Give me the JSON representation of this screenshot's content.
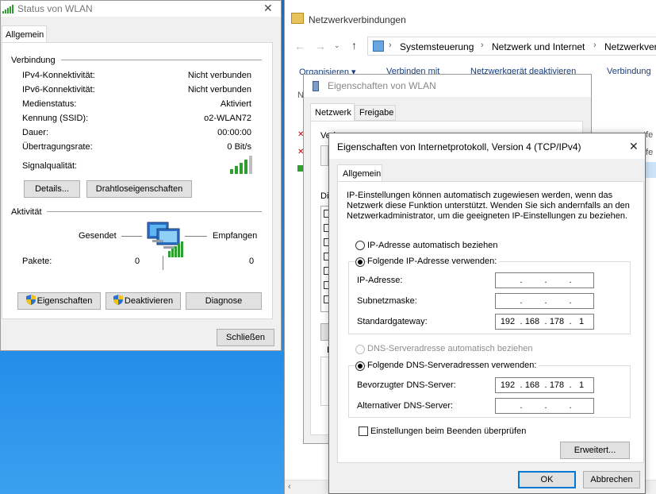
{
  "status_window": {
    "title": "Status von WLAN",
    "close": "✕",
    "tab": "Allgemein",
    "connection_header": "Verbindung",
    "rows": [
      {
        "label": "IPv4-Konnektivität:",
        "value": "Nicht verbunden"
      },
      {
        "label": "IPv6-Konnektivität:",
        "value": "Nicht verbunden"
      },
      {
        "label": "Medienstatus:",
        "value": "Aktiviert"
      },
      {
        "label": "Kennung (SSID):",
        "value": "o2-WLAN72"
      },
      {
        "label": "Dauer:",
        "value": "00:00:00"
      },
      {
        "label": "Übertragungsrate:",
        "value": "0 Bit/s"
      }
    ],
    "signal_label": "Signalqualität:",
    "details_button": "Details...",
    "wireless_button": "Drahtloseigenschaften",
    "activity_header": "Aktivität",
    "sent_label": "Gesendet",
    "received_label": "Empfangen",
    "packets_label": "Pakete:",
    "packets_sent": "0",
    "packets_received": "0",
    "properties_button": "Eigenschaften",
    "disable_button": "Deaktivieren",
    "diagnose_button": "Diagnose",
    "close_button": "Schließen"
  },
  "explorer": {
    "title": "Netzwerkverbindungen",
    "breadcrumb": [
      "Systemsteuerung",
      "Netzwerk und Internet",
      "Netzwerkverb"
    ],
    "toolbar": [
      "Organisieren ▾",
      "Verbinden mit",
      "Netzwerkgerät deaktivieren",
      "Verbindung"
    ],
    "partial_left": "N",
    "partial_right_1": "tfe",
    "partial_right_2": "tfe"
  },
  "wlan_props": {
    "title": "Eigenschaften von WLAN",
    "tabs": [
      "Netzwerk",
      "Freigabe"
    ],
    "partial_connect": "Verbindung herstellen über:",
    "partial_items": "Die",
    "partial_b": "B"
  },
  "ipv4": {
    "title": "Eigenschaften von Internetprotokoll, Version 4 (TCP/IPv4)",
    "tab": "Allgemein",
    "description": "IP-Einstellungen können automatisch zugewiesen werden, wenn das Netzwerk diese Funktion unterstützt. Wenden Sie sich andernfalls an den Netzwerkadministrator, um die geeigneten IP-Einstellungen zu beziehen.",
    "radio_auto_ip": "IP-Adresse automatisch beziehen",
    "radio_manual_ip": "Folgende IP-Adresse verwenden:",
    "ip_label": "IP-Adresse:",
    "subnet_label": "Subnetzmaske:",
    "gateway_label": "Standardgateway:",
    "ip_value": [
      "",
      "",
      "",
      ""
    ],
    "subnet_value": [
      "",
      "",
      "",
      ""
    ],
    "gateway_value": [
      "192",
      "168",
      "178",
      "1"
    ],
    "radio_auto_dns": "DNS-Serveradresse automatisch beziehen",
    "radio_manual_dns": "Folgende DNS-Serveradressen verwenden:",
    "pref_dns_label": "Bevorzugter DNS-Server:",
    "alt_dns_label": "Alternativer DNS-Server:",
    "pref_dns_value": [
      "192",
      "168",
      "178",
      "1"
    ],
    "alt_dns_value": [
      "",
      "",
      "",
      ""
    ],
    "validate_label": "Einstellungen beim Beenden überprüfen",
    "advanced_button": "Erweitert...",
    "ok_button": "OK",
    "cancel_button": "Abbrechen",
    "close": "✕"
  },
  "colors": {
    "accent": "#0078d7",
    "signal_green": "#2e9e2e",
    "error_red": "#cc0000"
  }
}
